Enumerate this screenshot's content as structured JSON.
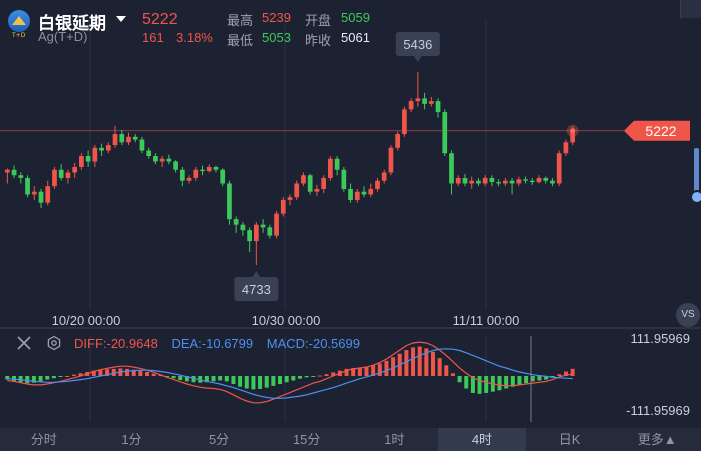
{
  "header": {
    "logo_text": "T+D",
    "name": "白银延期",
    "symbol": "Ag(T+D)",
    "last_price": "5222",
    "change": "161",
    "change_pct": "3.18%",
    "stats": {
      "high_label": "最高",
      "high_value": "5239",
      "open_label": "开盘",
      "open_value": "5059",
      "low_label": "最低",
      "low_value": "5053",
      "prev_close_label": "昨收",
      "prev_close_value": "5061"
    }
  },
  "colors": {
    "up": "#f0554a",
    "down": "#3dc95a",
    "diff": "#f0554a",
    "dea": "#4d8ff0",
    "macd": "#4d8ff0",
    "background": "#1d2233"
  },
  "chart_data": [
    {
      "type": "candlestick",
      "x_ticks": [
        "10/20 00:00",
        "10/30 00:00",
        "11/11 00:00"
      ],
      "annotations": {
        "high": "5436",
        "low": "4733",
        "last": "5222"
      },
      "series": [
        {
          "values": [
            [
              5070,
              5080,
              5030,
              5085
            ],
            [
              5080,
              5060,
              5050,
              5095
            ],
            [
              5060,
              5050,
              5030,
              5070
            ],
            [
              5050,
              4990,
              4980,
              5060
            ],
            [
              4990,
              5000,
              4970,
              5020
            ],
            [
              5000,
              4960,
              4940,
              5010
            ],
            [
              4960,
              5020,
              4950,
              5040
            ],
            [
              5020,
              5080,
              5010,
              5090
            ],
            [
              5080,
              5050,
              5040,
              5100
            ],
            [
              5050,
              5070,
              5030,
              5080
            ],
            [
              5070,
              5090,
              5050,
              5105
            ],
            [
              5090,
              5130,
              5080,
              5140
            ],
            [
              5130,
              5110,
              5090,
              5150
            ],
            [
              5110,
              5160,
              5090,
              5170
            ],
            [
              5160,
              5150,
              5130,
              5175
            ],
            [
              5150,
              5170,
              5140,
              5180
            ],
            [
              5170,
              5210,
              5160,
              5240
            ],
            [
              5210,
              5180,
              5170,
              5225
            ],
            [
              5180,
              5200,
              5170,
              5215
            ],
            [
              5200,
              5190,
              5180,
              5210
            ],
            [
              5190,
              5150,
              5140,
              5200
            ],
            [
              5150,
              5130,
              5120,
              5160
            ],
            [
              5130,
              5110,
              5100,
              5140
            ],
            [
              5110,
              5120,
              5090,
              5130
            ],
            [
              5120,
              5110,
              5100,
              5135
            ],
            [
              5110,
              5080,
              5070,
              5115
            ],
            [
              5080,
              5040,
              5020,
              5090
            ],
            [
              5040,
              5050,
              5030,
              5060
            ],
            [
              5050,
              5080,
              5040,
              5090
            ],
            [
              5080,
              5075,
              5060,
              5095
            ],
            [
              5075,
              5090,
              5070,
              5100
            ],
            [
              5090,
              5080,
              5070,
              5095
            ],
            [
              5080,
              5030,
              5020,
              5085
            ],
            [
              5030,
              4900,
              4880,
              5040
            ],
            [
              4900,
              4880,
              4850,
              4910
            ],
            [
              4880,
              4860,
              4840,
              4890
            ],
            [
              4860,
              4820,
              4780,
              4870
            ],
            [
              4820,
              4880,
              4733,
              4890
            ],
            [
              4880,
              4870,
              4850,
              4900
            ],
            [
              4870,
              4840,
              4830,
              4880
            ],
            [
              4840,
              4920,
              4830,
              4930
            ],
            [
              4920,
              4970,
              4910,
              4980
            ],
            [
              4970,
              4980,
              4950,
              4990
            ],
            [
              4980,
              5030,
              4970,
              5040
            ],
            [
              5030,
              5060,
              5020,
              5070
            ],
            [
              5060,
              5000,
              4990,
              5065
            ],
            [
              5000,
              5010,
              4985,
              5025
            ],
            [
              5010,
              5050,
              4995,
              5060
            ],
            [
              5050,
              5120,
              5040,
              5130
            ],
            [
              5120,
              5080,
              5060,
              5130
            ],
            [
              5080,
              5010,
              5000,
              5090
            ],
            [
              5010,
              4970,
              4960,
              5030
            ],
            [
              4970,
              5000,
              4960,
              5010
            ],
            [
              5000,
              4990,
              4980,
              5020
            ],
            [
              4990,
              5010,
              4980,
              5030
            ],
            [
              5010,
              5040,
              5000,
              5050
            ],
            [
              5040,
              5070,
              5030,
              5080
            ],
            [
              5070,
              5160,
              5060,
              5170
            ],
            [
              5160,
              5210,
              5150,
              5220
            ],
            [
              5210,
              5300,
              5200,
              5310
            ],
            [
              5300,
              5330,
              5290,
              5340
            ],
            [
              5330,
              5340,
              5310,
              5436
            ],
            [
              5340,
              5320,
              5300,
              5360
            ],
            [
              5320,
              5330,
              5310,
              5345
            ],
            [
              5330,
              5290,
              5270,
              5340
            ],
            [
              5290,
              5140,
              5130,
              5300
            ],
            [
              5140,
              5030,
              4990,
              5150
            ],
            [
              5030,
              5050,
              5020,
              5060
            ],
            [
              5050,
              5030,
              5020,
              5065
            ],
            [
              5030,
              5040,
              5010,
              5055
            ],
            [
              5040,
              5030,
              5020,
              5050
            ],
            [
              5030,
              5050,
              5020,
              5060
            ],
            [
              5050,
              5035,
              5020,
              5060
            ],
            [
              5035,
              5030,
              5020,
              5045
            ],
            [
              5030,
              5040,
              5020,
              5050
            ],
            [
              5040,
              5030,
              4990,
              5050
            ],
            [
              5030,
              5045,
              5020,
              5055
            ],
            [
              5045,
              5040,
              5030,
              5055
            ],
            [
              5040,
              5035,
              5025,
              5050
            ],
            [
              5035,
              5050,
              5030,
              5060
            ],
            [
              5050,
              5040,
              5030,
              5055
            ],
            [
              5040,
              5030,
              5020,
              5050
            ],
            [
              5030,
              5140,
              5020,
              5150
            ],
            [
              5140,
              5180,
              5130,
              5190
            ],
            [
              5180,
              5222,
              5170,
              5239
            ]
          ]
        }
      ],
      "reference_line": 5222
    },
    {
      "type": "bar",
      "title": "",
      "indicators": {
        "diff": "DIFF:-20.9648",
        "dea": "DEA:-10.6799",
        "macd": "MACD:-20.5699"
      },
      "ylim_labels": {
        "top": "111.95969",
        "bottom": "-111.95969"
      },
      "ylim": [
        -111.95969,
        111.95969
      ],
      "bars": [
        -8,
        -12,
        -14,
        -16,
        -15,
        -13,
        -8,
        -5,
        -2,
        0,
        3,
        6,
        9,
        12,
        14,
        15,
        16,
        17,
        16,
        14,
        12,
        9,
        5,
        2,
        -2,
        -5,
        -9,
        -12,
        -14,
        -15,
        -14,
        -12,
        -10,
        -12,
        -18,
        -24,
        -28,
        -30,
        -29,
        -26,
        -22,
        -18,
        -14,
        -10,
        -6,
        -3,
        -1,
        1,
        4,
        8,
        12,
        16,
        18,
        18,
        20,
        24,
        28,
        34,
        42,
        50,
        58,
        64,
        66,
        62,
        54,
        40,
        24,
        6,
        -14,
        -28,
        -38,
        -40,
        -38,
        -35,
        -32,
        -28,
        -24,
        -20,
        -16,
        -12,
        -10,
        -8,
        -4,
        4,
        10,
        16
      ],
      "diff": [
        -10,
        -12,
        -15,
        -18,
        -20,
        -20,
        -18,
        -15,
        -12,
        -8,
        -4,
        0,
        5,
        10,
        14,
        17,
        20,
        22,
        22,
        20,
        17,
        13,
        8,
        3,
        -3,
        -8,
        -13,
        -18,
        -22,
        -25,
        -27,
        -28,
        -30,
        -35,
        -42,
        -50,
        -56,
        -60,
        -60,
        -57,
        -52,
        -46,
        -40,
        -34,
        -28,
        -22,
        -16,
        -12,
        -6,
        0,
        6,
        12,
        16,
        18,
        20,
        24,
        30,
        38,
        48,
        58,
        68,
        74,
        76,
        74,
        68,
        58,
        46,
        32,
        18,
        6,
        -4,
        -10,
        -14,
        -18,
        -20,
        -22,
        -22,
        -20,
        -18,
        -16,
        -14,
        -12,
        -8,
        -2,
        2,
        4
      ],
      "dea": [
        -6,
        -7,
        -8,
        -10,
        -12,
        -13,
        -14,
        -14,
        -13,
        -12,
        -10,
        -8,
        -6,
        -3,
        0,
        3,
        6,
        9,
        11,
        12,
        13,
        13,
        12,
        10,
        8,
        5,
        2,
        -2,
        -5,
        -9,
        -12,
        -15,
        -18,
        -22,
        -26,
        -31,
        -36,
        -41,
        -45,
        -48,
        -50,
        -50,
        -49,
        -47,
        -45,
        -42,
        -38,
        -34,
        -30,
        -26,
        -21,
        -16,
        -11,
        -6,
        -2,
        2,
        7,
        12,
        18,
        25,
        32,
        39,
        46,
        52,
        57,
        60,
        61,
        60,
        57,
        52,
        46,
        40,
        34,
        28,
        22,
        18,
        13,
        9,
        6,
        3,
        1,
        -1,
        -3,
        -4,
        -5,
        -6
      ]
    }
  ],
  "toolbar": {
    "tabs": [
      "分时",
      "1分",
      "5分",
      "15分",
      "1时",
      "4时",
      "日K",
      "更多▲"
    ],
    "active_index": 5,
    "vs_label": "VS"
  }
}
